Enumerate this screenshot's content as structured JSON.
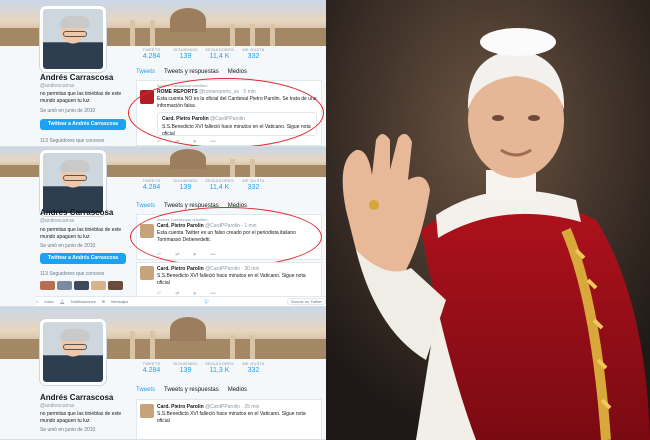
{
  "profile": {
    "name": "Andrés Carrascosa",
    "handle": "@andrescarras",
    "bio": "no permitas que las tinieblas de este mundo apaguen tu luz",
    "joined": "Se unió en junio de 2010",
    "follow_button": "Twittear a Andrés Carrascosa",
    "followers_you_know": "113 Seguidores que conoces"
  },
  "stat_labels": [
    "TWEETS",
    "SIGUIENDO",
    "SEGUIDORES",
    "ME GUSTA"
  ],
  "panels": [
    {
      "stats": [
        "4.284",
        "139",
        "11,4 K",
        "332"
      ]
    },
    {
      "stats": [
        "4.284",
        "139",
        "11,4 K",
        "332"
      ]
    },
    {
      "stats": [
        "4.284",
        "139",
        "11,3 K",
        "332"
      ]
    }
  ],
  "tabs": [
    "Tweets",
    "Tweets y respuestas",
    "Medios"
  ],
  "retweet_context": "Andrés Carrascosa retwitteó",
  "tweets": {
    "rome_reports": {
      "author": "ROME REPORTS",
      "handle": "@romereports_es · 5 min",
      "text": "Esta cuenta NO es la oficial del Cardenal Pietro Parolin. Se trata de una información falsa",
      "quote_author": "Card. Pietro Parolin",
      "quote_handle": "@CardPParolin",
      "quote_text": "S.S.Benedicto XVI falleció hace minutos en el Vaticano.  Sigue nota oficial"
    },
    "parolin_fake": {
      "author": "Card. Pietro Parolin",
      "handle": "@CardPParolin · 1 min",
      "text": "Esta cuenta Twitter es un falso creado por el periodista italiano Tommasso Debenedetti."
    },
    "parolin_death": {
      "author": "Card. Pietro Parolin",
      "handle_30": "@CardPParolin · 30 min",
      "handle_25": "@CardPParolin · 25 min",
      "text": "S.S.Benedicto XVI falleció hace minutos en el Vaticano.  Sigue nota oficial"
    }
  },
  "bottom_bar": {
    "home": "Inicio",
    "notifications": "Notificaciones",
    "messages": "Mensajes",
    "search_placeholder": "Buscar en Twitter"
  },
  "colors": {
    "twitter_blue": "#1da1f2",
    "highlight_red": "#e0282d"
  }
}
